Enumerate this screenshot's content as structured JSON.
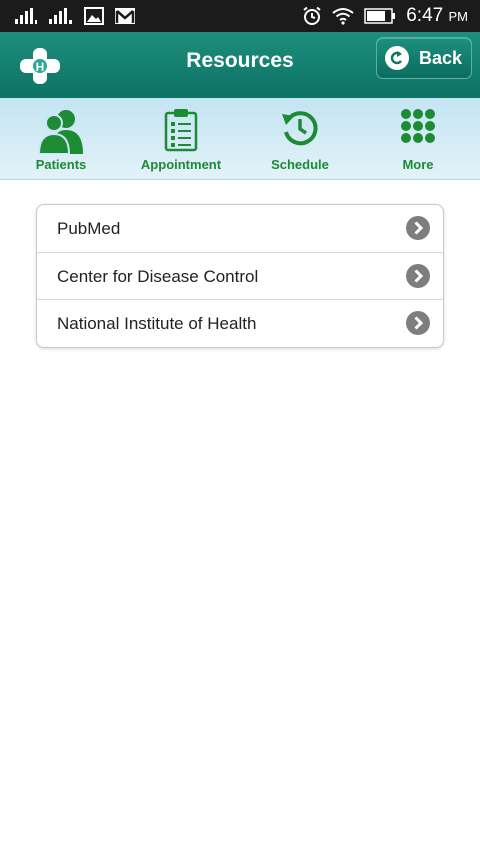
{
  "status_bar": {
    "time": "6:47",
    "ampm": "PM",
    "icons": [
      "signal-icon",
      "signal-icon",
      "image-icon",
      "gmail-icon",
      "alarm-icon",
      "wifi-icon",
      "battery-icon"
    ]
  },
  "header": {
    "title": "Resources",
    "back_label": "Back",
    "logo_letter": "H"
  },
  "tabs": [
    {
      "label": "Patients",
      "icon": "patients-icon"
    },
    {
      "label": "Appointment",
      "icon": "clipboard-icon"
    },
    {
      "label": "Schedule",
      "icon": "history-icon"
    },
    {
      "label": "More",
      "icon": "grid-icon"
    }
  ],
  "resources": [
    {
      "label": "PubMed"
    },
    {
      "label": "Center for Disease Control"
    },
    {
      "label": "National Institute of Health"
    }
  ],
  "colors": {
    "header": "#0d7364",
    "tab_green": "#1d8a34",
    "tabbar": "#c3e4f2",
    "status_bar": "#1b1b1b"
  }
}
